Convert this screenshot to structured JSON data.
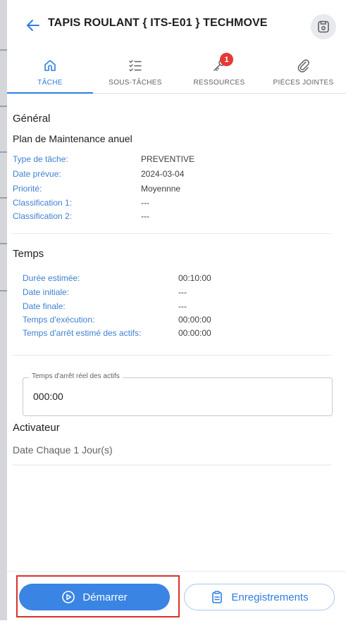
{
  "header": {
    "title": "TAPIS ROULANT { ITS-E01 } TECHMOVE",
    "back_icon": "arrow-left-icon",
    "save_icon": "save-icon"
  },
  "tabs": [
    {
      "label": "TÂCHE",
      "icon": "home-icon",
      "active": true
    },
    {
      "label": "SOUS-TÂCHES",
      "icon": "checklist-icon",
      "active": false
    },
    {
      "label": "RESSOURCES",
      "icon": "key-icon",
      "active": false,
      "badge": "1"
    },
    {
      "label": "PIÈCES JOINTES",
      "icon": "paperclip-icon",
      "active": false
    }
  ],
  "general": {
    "heading": "Général",
    "plan": "Plan de Maintenance anuel",
    "rows": [
      {
        "label": "Type de tâche:",
        "value": "PREVENTIVE"
      },
      {
        "label": "Date prévue:",
        "value": "2024-03-04"
      },
      {
        "label": "Priorité:",
        "value": "Moyennne"
      },
      {
        "label": "Classification 1:",
        "value": "---"
      },
      {
        "label": "Classification 2:",
        "value": "---"
      }
    ]
  },
  "temps": {
    "heading": "Temps",
    "rows": [
      {
        "label": "Durée estimée:",
        "value": "00:10:00"
      },
      {
        "label": "Date initiale:",
        "value": "---"
      },
      {
        "label": "Date finale:",
        "value": "---"
      },
      {
        "label": "Temps d'exécution:",
        "value": "00:00:00"
      },
      {
        "label": "Temps d'arrêt estimé des actifs:",
        "value": "00:00:00"
      }
    ]
  },
  "downtime_field": {
    "label": "Temps d'arrêt réel des actifs",
    "value": "000:00"
  },
  "activateur": {
    "heading": "Activateur",
    "text": "Date Chaque 1 Jour(s)"
  },
  "actions": {
    "start_label": "Démarrer",
    "records_label": "Enregistrements"
  },
  "colors": {
    "accent": "#2f7de1",
    "badge": "#e53935",
    "highlight": "#d9312b"
  }
}
